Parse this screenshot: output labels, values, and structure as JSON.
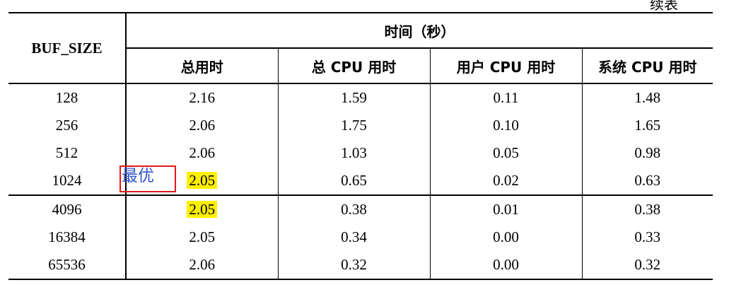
{
  "corner_text": "续表",
  "header": {
    "buf_size": "BUF_SIZE",
    "time_group": "时间（秒）",
    "columns": [
      "总用时",
      "总 CPU 用时",
      "用户 CPU 用时",
      "系统 CPU 用时"
    ]
  },
  "rows": [
    {
      "buf_size": "128",
      "total": "2.16",
      "total_cpu": "1.59",
      "user_cpu": "0.11",
      "sys_cpu": "1.48"
    },
    {
      "buf_size": "256",
      "total": "2.06",
      "total_cpu": "1.75",
      "user_cpu": "0.10",
      "sys_cpu": "1.65"
    },
    {
      "buf_size": "512",
      "total": "2.06",
      "total_cpu": "1.03",
      "user_cpu": "0.05",
      "sys_cpu": "0.98"
    },
    {
      "buf_size": "1024",
      "total": "2.05",
      "total_cpu": "0.65",
      "user_cpu": "0.02",
      "sys_cpu": "0.63"
    },
    {
      "buf_size": "4096",
      "total": "2.05",
      "total_cpu": "0.38",
      "user_cpu": "0.01",
      "sys_cpu": "0.38"
    },
    {
      "buf_size": "16384",
      "total": "2.05",
      "total_cpu": "0.34",
      "user_cpu": "0.00",
      "sys_cpu": "0.33"
    },
    {
      "buf_size": "65536",
      "total": "2.06",
      "total_cpu": "0.32",
      "user_cpu": "0.00",
      "sys_cpu": "0.32"
    }
  ],
  "annotation": {
    "label": "最优",
    "box_color": "#e0191b",
    "label_color": "#2f56c6",
    "highlight_color": "#ffef00"
  }
}
